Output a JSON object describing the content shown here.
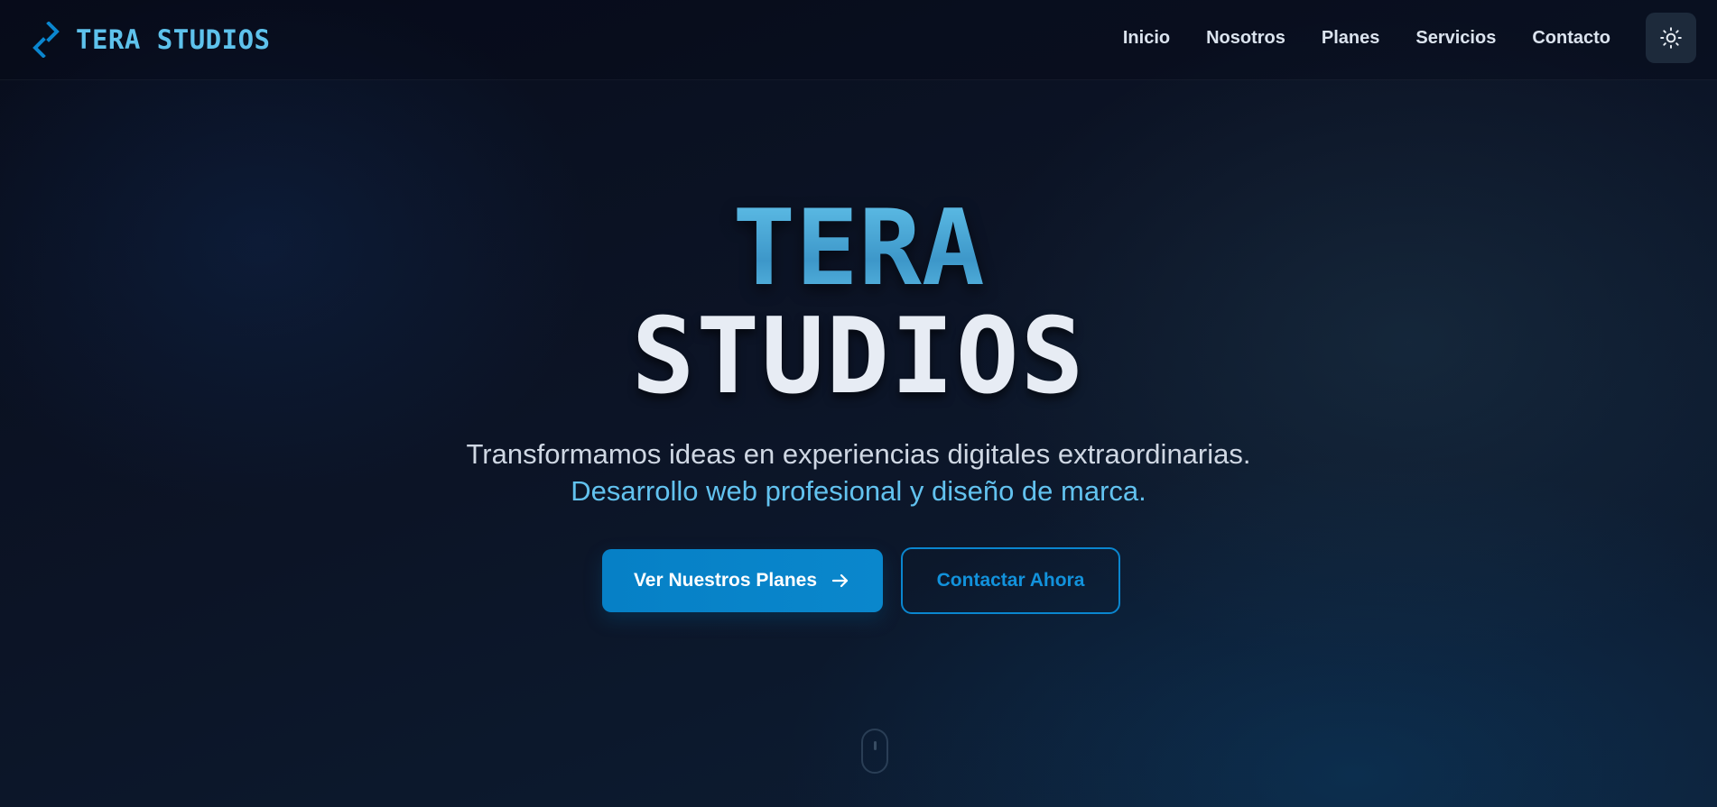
{
  "brand": {
    "name": "TERA STUDIOS",
    "icon": "chevron-brackets-logo-icon",
    "color": "#5ec2ec"
  },
  "nav": {
    "items": [
      {
        "label": "Inicio"
      },
      {
        "label": "Nosotros"
      },
      {
        "label": "Planes"
      },
      {
        "label": "Servicios"
      },
      {
        "label": "Contacto"
      }
    ],
    "theme_toggle_icon": "sun-icon"
  },
  "hero": {
    "title_line_1": "TERA",
    "title_line_2": "STUDIOS",
    "tagline": "Transformamos ideas en experiencias digitales extraordinarias.",
    "tagline_accent": "Desarrollo web profesional y diseño de marca.",
    "primary_button": {
      "label": "Ver Nuestros Planes",
      "icon": "arrow-right-icon"
    },
    "secondary_button": {
      "label": "Contactar Ahora"
    },
    "scroll_indicator_icon": "mouse-scroll-icon"
  },
  "colors": {
    "accent": "#0a86cf",
    "accent_light": "#62c2ef",
    "background": "#0c1426",
    "text": "#e2e8f0"
  }
}
